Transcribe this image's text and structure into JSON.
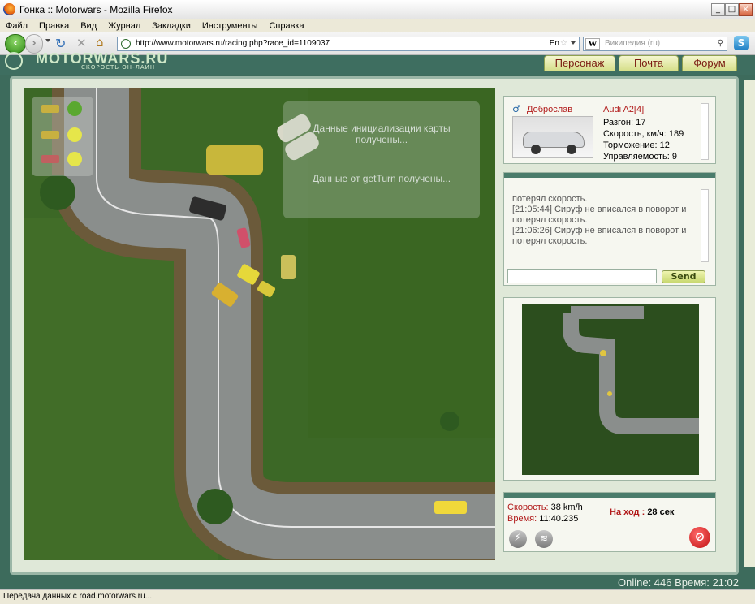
{
  "window": {
    "title": "Гонка :: Motorwars - Mozilla Firefox",
    "min": "_",
    "max": "□",
    "close": "×"
  },
  "menu": [
    "Файл",
    "Правка",
    "Вид",
    "Журнал",
    "Закладки",
    "Инструменты",
    "Справка"
  ],
  "nav": {
    "url": "http://www.motorwars.ru/racing.php?race_id=1109037",
    "search_placeholder": "Википедия (ru)",
    "lang": "En"
  },
  "site": {
    "logo": "MOTORWARS.RU",
    "tagline": "СКОРОСТЬ ОН-ЛАЙН",
    "buttons": [
      "Персонаж",
      "Почта",
      "Форум"
    ]
  },
  "map": {
    "overlay_msgs": [
      "Данные инициализации карты получены...",
      "Данные от getTurn получены..."
    ]
  },
  "player": {
    "name": "Доброслав",
    "car": "Audi A2[4]",
    "stats": [
      "Разгон: 17",
      "Скорость, км/ч: 189",
      "Торможение: 12",
      "Управляемость: 9"
    ]
  },
  "chat": {
    "lines": [
      "потерял скорость.",
      "[21:05:44] Сируф не вписался в поворот и потерял скорость.",
      "[21:06:26] Сируф не вписался в поворот и потерял скорость."
    ],
    "send": "Send"
  },
  "info": {
    "speed_label": "Скорость:",
    "speed_value": "38 km/h",
    "time_label": "Время:",
    "time_value": "11:40.235",
    "turn_label": "На ход :",
    "turn_value": "28 сек"
  },
  "footer": {
    "online": "Online: 446",
    "clock": "Время: 21:02"
  },
  "status": "Передача данных с road.motorwars.ru..."
}
